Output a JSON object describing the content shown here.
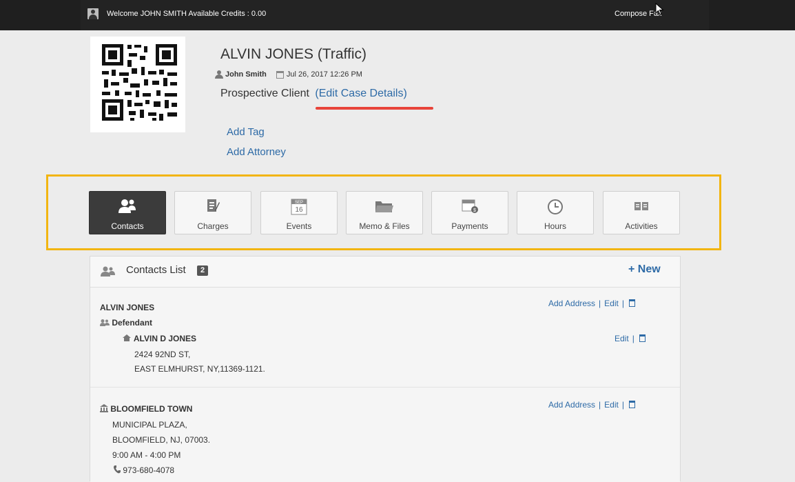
{
  "topbar": {
    "welcome_text": "Welcome JOHN SMITH  Available Credits : 0.00",
    "compose_fax_label": "Compose Fax"
  },
  "case": {
    "title": "ALVIN JONES (Traffic)",
    "user_name": "John Smith",
    "date": "Jul 26, 2017 12:26 PM",
    "status": "Prospective Client",
    "edit_details_link": "(Edit Case Details)",
    "add_tag_link": "Add Tag",
    "add_attorney_link": "Add Attorney"
  },
  "tabs": [
    {
      "label": "Contacts",
      "icon": "contacts-icon",
      "active": true
    },
    {
      "label": "Charges",
      "icon": "charges-icon",
      "active": false
    },
    {
      "label": "Events",
      "icon": "calendar-icon",
      "active": false
    },
    {
      "label": "Memo & Files",
      "icon": "folder-icon",
      "active": false
    },
    {
      "label": "Payments",
      "icon": "payments-icon",
      "active": false
    },
    {
      "label": "Hours",
      "icon": "clock-icon",
      "active": false
    },
    {
      "label": "Activities",
      "icon": "book-icon",
      "active": false
    }
  ],
  "events_icon_text": {
    "month": "SEP",
    "day": "16"
  },
  "contacts_panel": {
    "title": "Contacts List",
    "count": "2",
    "new_label": "New"
  },
  "contacts": [
    {
      "name": "ALVIN JONES",
      "role": "Defendant",
      "actions": {
        "add_address": "Add Address",
        "edit": "Edit"
      },
      "address": {
        "name": "ALVIN D JONES",
        "line1": "2424 92ND ST,",
        "line2": "EAST ELMHURST, NY,11369-1121.",
        "edit": "Edit"
      }
    },
    {
      "name": "BLOOMFIELD TOWN",
      "line1": "MUNICIPAL PLAZA,",
      "line2": "BLOOMFIELD, NJ, 07003.",
      "hours": "9:00 AM - 4:00 PM",
      "phone": "973-680-4078",
      "actions": {
        "add_address": "Add Address",
        "edit": "Edit"
      }
    }
  ],
  "colors": {
    "accent_link": "#2d6aa6",
    "highlight_frame": "#f2b511",
    "underline": "#e8443a",
    "active_tab": "#3b3b3b"
  }
}
